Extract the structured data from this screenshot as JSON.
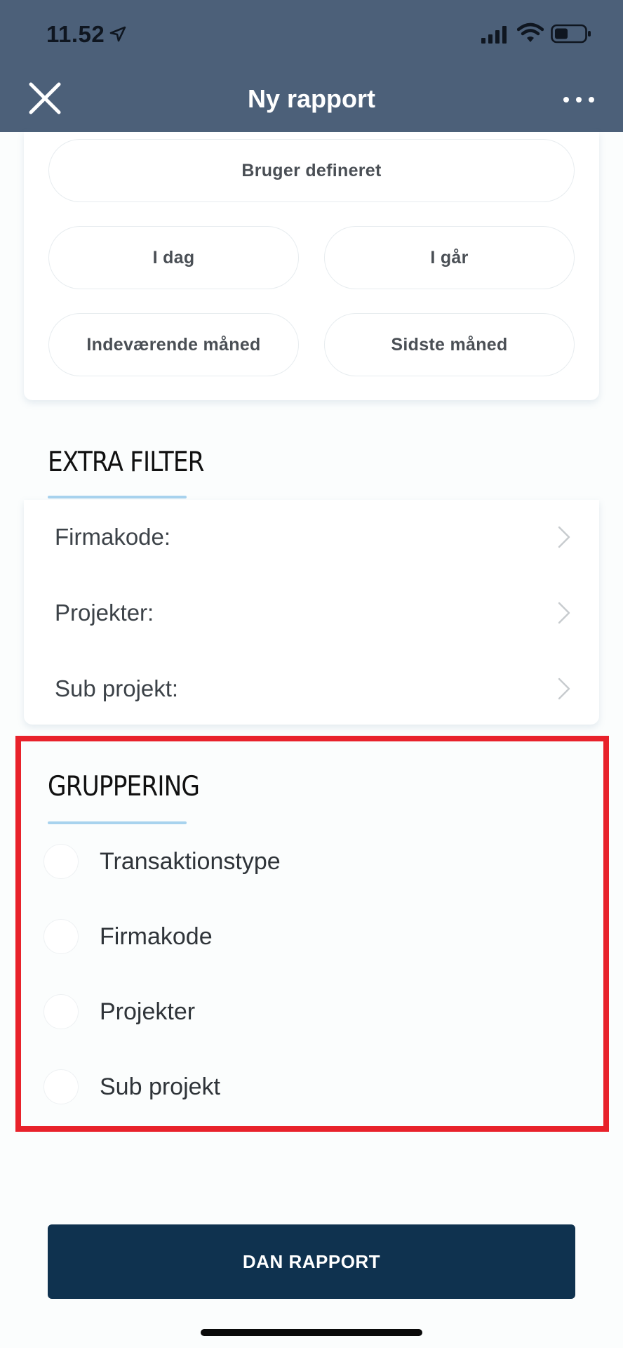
{
  "status_bar": {
    "time": "11.52"
  },
  "header": {
    "title": "Ny rapport"
  },
  "date_options": [
    {
      "label": "Bruger defineret"
    },
    {
      "label": "I dag"
    },
    {
      "label": "I går"
    },
    {
      "label": "Indeværende måned"
    },
    {
      "label": "Sidste måned"
    }
  ],
  "extra_filter": {
    "title": "EXTRA FILTER",
    "rows": [
      {
        "label": "Firmakode:"
      },
      {
        "label": "Projekter:"
      },
      {
        "label": "Sub projekt:"
      }
    ]
  },
  "gruppering": {
    "title": "GRUPPERING",
    "options": [
      {
        "label": "Transaktionstype"
      },
      {
        "label": "Firmakode"
      },
      {
        "label": "Projekter"
      },
      {
        "label": "Sub projekt"
      }
    ]
  },
  "action": {
    "label": "DAN RAPPORT"
  },
  "colors": {
    "header_bg": "#4c6079",
    "button_bg": "#0f324f",
    "underline": "#a8d3ee",
    "highlight": "#e8222b"
  }
}
